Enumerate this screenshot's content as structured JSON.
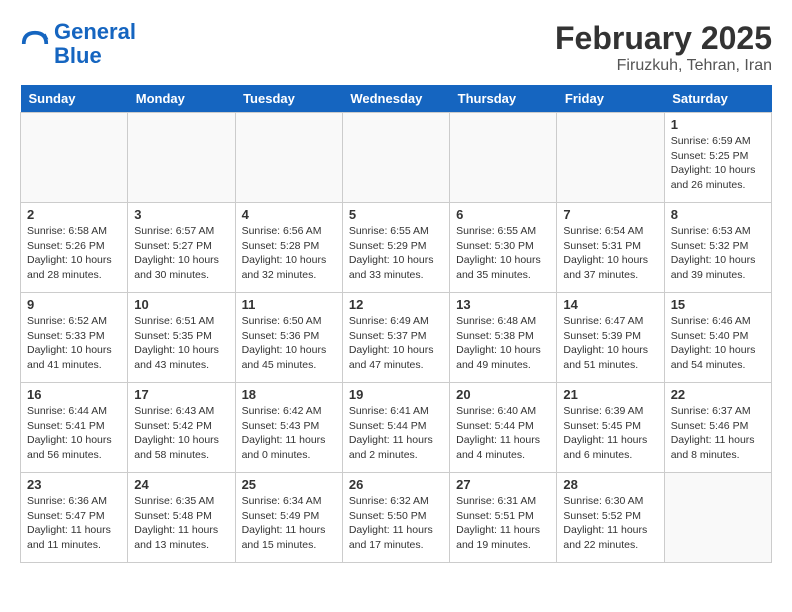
{
  "header": {
    "logo_line1": "General",
    "logo_line2": "Blue",
    "month": "February 2025",
    "location": "Firuzkuh, Tehran, Iran"
  },
  "weekdays": [
    "Sunday",
    "Monday",
    "Tuesday",
    "Wednesday",
    "Thursday",
    "Friday",
    "Saturday"
  ],
  "weeks": [
    [
      {
        "day": "",
        "info": ""
      },
      {
        "day": "",
        "info": ""
      },
      {
        "day": "",
        "info": ""
      },
      {
        "day": "",
        "info": ""
      },
      {
        "day": "",
        "info": ""
      },
      {
        "day": "",
        "info": ""
      },
      {
        "day": "1",
        "info": "Sunrise: 6:59 AM\nSunset: 5:25 PM\nDaylight: 10 hours and 26 minutes."
      }
    ],
    [
      {
        "day": "2",
        "info": "Sunrise: 6:58 AM\nSunset: 5:26 PM\nDaylight: 10 hours and 28 minutes."
      },
      {
        "day": "3",
        "info": "Sunrise: 6:57 AM\nSunset: 5:27 PM\nDaylight: 10 hours and 30 minutes."
      },
      {
        "day": "4",
        "info": "Sunrise: 6:56 AM\nSunset: 5:28 PM\nDaylight: 10 hours and 32 minutes."
      },
      {
        "day": "5",
        "info": "Sunrise: 6:55 AM\nSunset: 5:29 PM\nDaylight: 10 hours and 33 minutes."
      },
      {
        "day": "6",
        "info": "Sunrise: 6:55 AM\nSunset: 5:30 PM\nDaylight: 10 hours and 35 minutes."
      },
      {
        "day": "7",
        "info": "Sunrise: 6:54 AM\nSunset: 5:31 PM\nDaylight: 10 hours and 37 minutes."
      },
      {
        "day": "8",
        "info": "Sunrise: 6:53 AM\nSunset: 5:32 PM\nDaylight: 10 hours and 39 minutes."
      }
    ],
    [
      {
        "day": "9",
        "info": "Sunrise: 6:52 AM\nSunset: 5:33 PM\nDaylight: 10 hours and 41 minutes."
      },
      {
        "day": "10",
        "info": "Sunrise: 6:51 AM\nSunset: 5:35 PM\nDaylight: 10 hours and 43 minutes."
      },
      {
        "day": "11",
        "info": "Sunrise: 6:50 AM\nSunset: 5:36 PM\nDaylight: 10 hours and 45 minutes."
      },
      {
        "day": "12",
        "info": "Sunrise: 6:49 AM\nSunset: 5:37 PM\nDaylight: 10 hours and 47 minutes."
      },
      {
        "day": "13",
        "info": "Sunrise: 6:48 AM\nSunset: 5:38 PM\nDaylight: 10 hours and 49 minutes."
      },
      {
        "day": "14",
        "info": "Sunrise: 6:47 AM\nSunset: 5:39 PM\nDaylight: 10 hours and 51 minutes."
      },
      {
        "day": "15",
        "info": "Sunrise: 6:46 AM\nSunset: 5:40 PM\nDaylight: 10 hours and 54 minutes."
      }
    ],
    [
      {
        "day": "16",
        "info": "Sunrise: 6:44 AM\nSunset: 5:41 PM\nDaylight: 10 hours and 56 minutes."
      },
      {
        "day": "17",
        "info": "Sunrise: 6:43 AM\nSunset: 5:42 PM\nDaylight: 10 hours and 58 minutes."
      },
      {
        "day": "18",
        "info": "Sunrise: 6:42 AM\nSunset: 5:43 PM\nDaylight: 11 hours and 0 minutes."
      },
      {
        "day": "19",
        "info": "Sunrise: 6:41 AM\nSunset: 5:44 PM\nDaylight: 11 hours and 2 minutes."
      },
      {
        "day": "20",
        "info": "Sunrise: 6:40 AM\nSunset: 5:44 PM\nDaylight: 11 hours and 4 minutes."
      },
      {
        "day": "21",
        "info": "Sunrise: 6:39 AM\nSunset: 5:45 PM\nDaylight: 11 hours and 6 minutes."
      },
      {
        "day": "22",
        "info": "Sunrise: 6:37 AM\nSunset: 5:46 PM\nDaylight: 11 hours and 8 minutes."
      }
    ],
    [
      {
        "day": "23",
        "info": "Sunrise: 6:36 AM\nSunset: 5:47 PM\nDaylight: 11 hours and 11 minutes."
      },
      {
        "day": "24",
        "info": "Sunrise: 6:35 AM\nSunset: 5:48 PM\nDaylight: 11 hours and 13 minutes."
      },
      {
        "day": "25",
        "info": "Sunrise: 6:34 AM\nSunset: 5:49 PM\nDaylight: 11 hours and 15 minutes."
      },
      {
        "day": "26",
        "info": "Sunrise: 6:32 AM\nSunset: 5:50 PM\nDaylight: 11 hours and 17 minutes."
      },
      {
        "day": "27",
        "info": "Sunrise: 6:31 AM\nSunset: 5:51 PM\nDaylight: 11 hours and 19 minutes."
      },
      {
        "day": "28",
        "info": "Sunrise: 6:30 AM\nSunset: 5:52 PM\nDaylight: 11 hours and 22 minutes."
      },
      {
        "day": "",
        "info": ""
      }
    ]
  ]
}
